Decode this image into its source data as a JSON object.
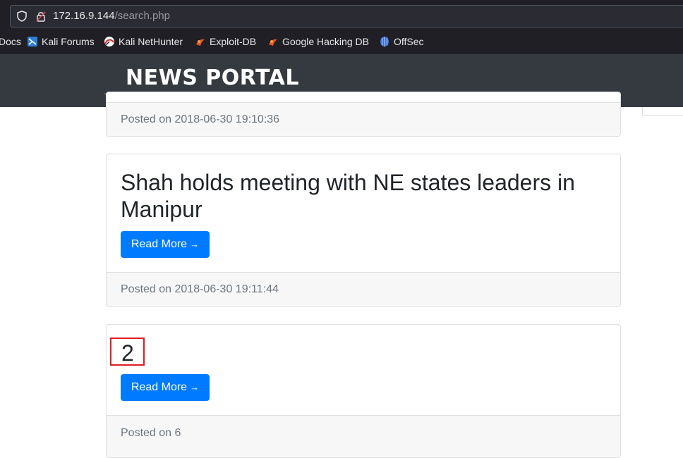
{
  "browser": {
    "url_host": "172.16.9.144",
    "url_path": "/search.php",
    "bookmarks": [
      {
        "label": "Docs",
        "icon": "docs-icon"
      },
      {
        "label": "Kali Forums",
        "icon": "kali-forums-icon"
      },
      {
        "label": "Kali NetHunter",
        "icon": "kali-nethunter-icon"
      },
      {
        "label": "Exploit-DB",
        "icon": "exploit-db-icon"
      },
      {
        "label": "Google Hacking DB",
        "icon": "google-hacking-db-icon"
      },
      {
        "label": "OffSec",
        "icon": "offsec-icon"
      }
    ]
  },
  "site": {
    "brand": "NEWS PORTAL",
    "colors": {
      "navbar": "#353a40",
      "button": "#007bff",
      "highlight": "#e11d1d"
    }
  },
  "posts": [
    {
      "title": "",
      "posted": "Posted on 2018-06-30 19:10:36"
    },
    {
      "title": "Shah holds meeting with NE states leaders in Manipur",
      "button": "Read More",
      "posted": "Posted on 2018-06-30 19:11:44"
    },
    {
      "title": "2",
      "button": "Read More",
      "posted": "Posted on 6"
    }
  ],
  "arrow": "→"
}
